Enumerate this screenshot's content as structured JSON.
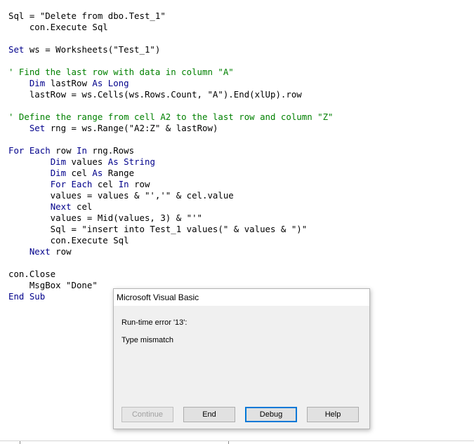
{
  "code": {
    "lines": [
      "Sql = \"Delete from dbo.Test_1\"",
      "    con.Execute Sql",
      "",
      "Set ws = Worksheets(\"Test_1\")",
      "",
      "' Find the last row with data in column \"A\"",
      "    Dim lastRow As Long",
      "    lastRow = ws.Cells(ws.Rows.Count, \"A\").End(xlUp).row",
      "",
      "' Define the range from cell A2 to the last row and column \"Z\"",
      "    Set rng = ws.Range(\"A2:Z\" & lastRow)",
      "",
      "For Each row In rng.Rows",
      "        Dim values As String",
      "        Dim cel As Range",
      "        For Each cel In row",
      "        values = values & \"','\" & cel.value",
      "        Next cel",
      "        values = Mid(values, 3) & \"'\"",
      "        Sql = \"insert into Test_1 values(\" & values & \")\"",
      "        con.Execute Sql",
      "    Next row",
      "",
      "con.Close",
      "    MsgBox \"Done\"",
      "End Sub"
    ]
  },
  "dialog": {
    "title": "Microsoft Visual Basic",
    "error_line": "Run-time error '13':",
    "message": "Type mismatch",
    "buttons": {
      "continue": "Continue",
      "end": "End",
      "debug": "Debug",
      "help": "Help"
    }
  },
  "colors": {
    "keyword": "#00008b",
    "comment": "#008000",
    "code": "#000000",
    "dialog_background": "#f0f0f0",
    "focus_border": "#0078d7"
  }
}
